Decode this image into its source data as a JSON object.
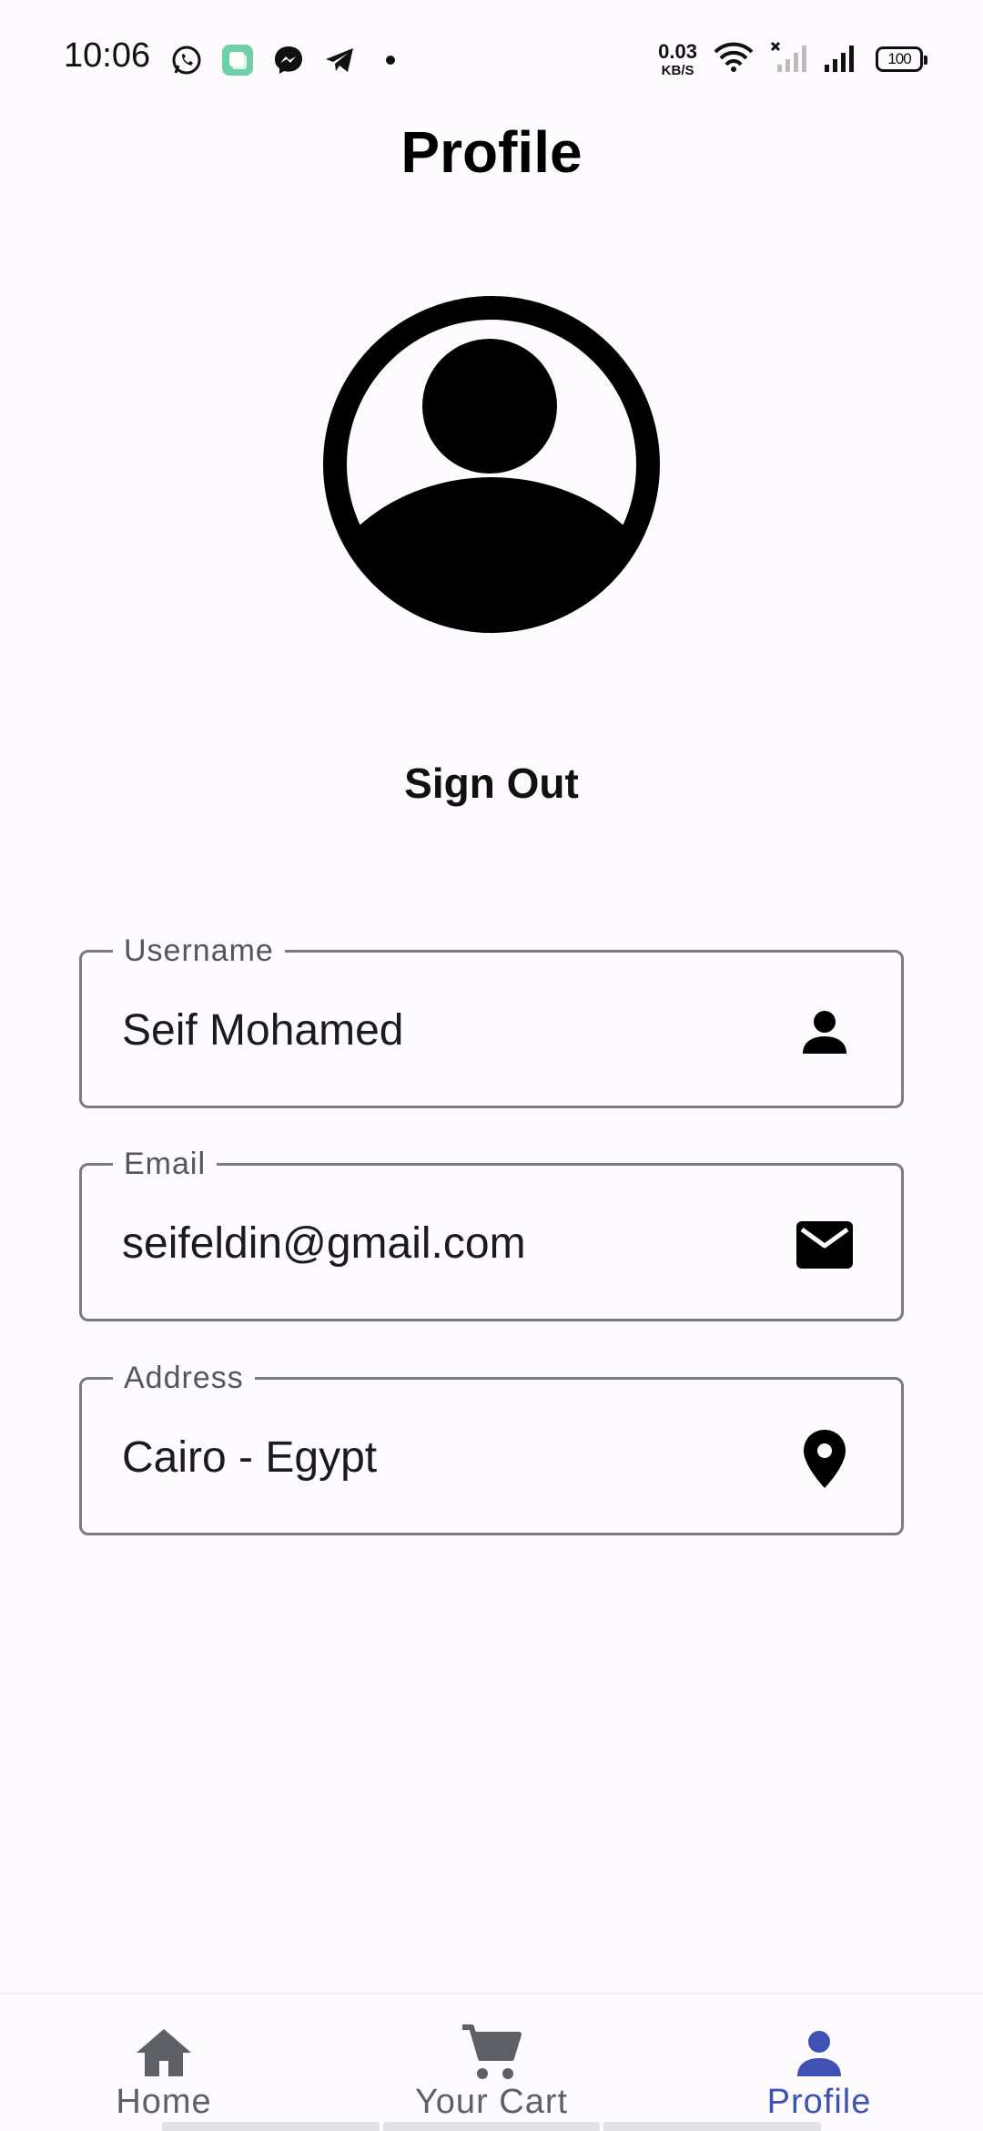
{
  "status_bar": {
    "time": "10:06",
    "net_speed_value": "0.03",
    "net_speed_unit": "KB/S",
    "battery": "100",
    "left_icons": [
      "whatsapp-icon",
      "app-icon",
      "messenger-icon",
      "telegram-icon",
      "dot-icon"
    ],
    "right_icons": [
      "wifi-icon",
      "signal-off-icon",
      "signal-icon",
      "battery-icon"
    ]
  },
  "header": {
    "title": "Profile"
  },
  "avatar": {
    "icon": "account-circle-icon"
  },
  "sign_out": {
    "label": "Sign Out"
  },
  "fields": {
    "username": {
      "label": "Username",
      "value": "Seif Mohamed",
      "icon": "person-icon"
    },
    "email": {
      "label": "Email",
      "value": "seifeldin@gmail.com",
      "icon": "mail-icon"
    },
    "address": {
      "label": "Address",
      "value": "Cairo - Egypt",
      "icon": "location-pin-icon"
    }
  },
  "bottom_nav": {
    "items": [
      {
        "label": "Home",
        "icon": "home-icon",
        "active": false
      },
      {
        "label": "Your Cart",
        "icon": "cart-icon",
        "active": false
      },
      {
        "label": "Profile",
        "icon": "person-icon",
        "active": true
      }
    ],
    "active_color": "#3f51b5",
    "inactive_color": "#5f5f66"
  }
}
